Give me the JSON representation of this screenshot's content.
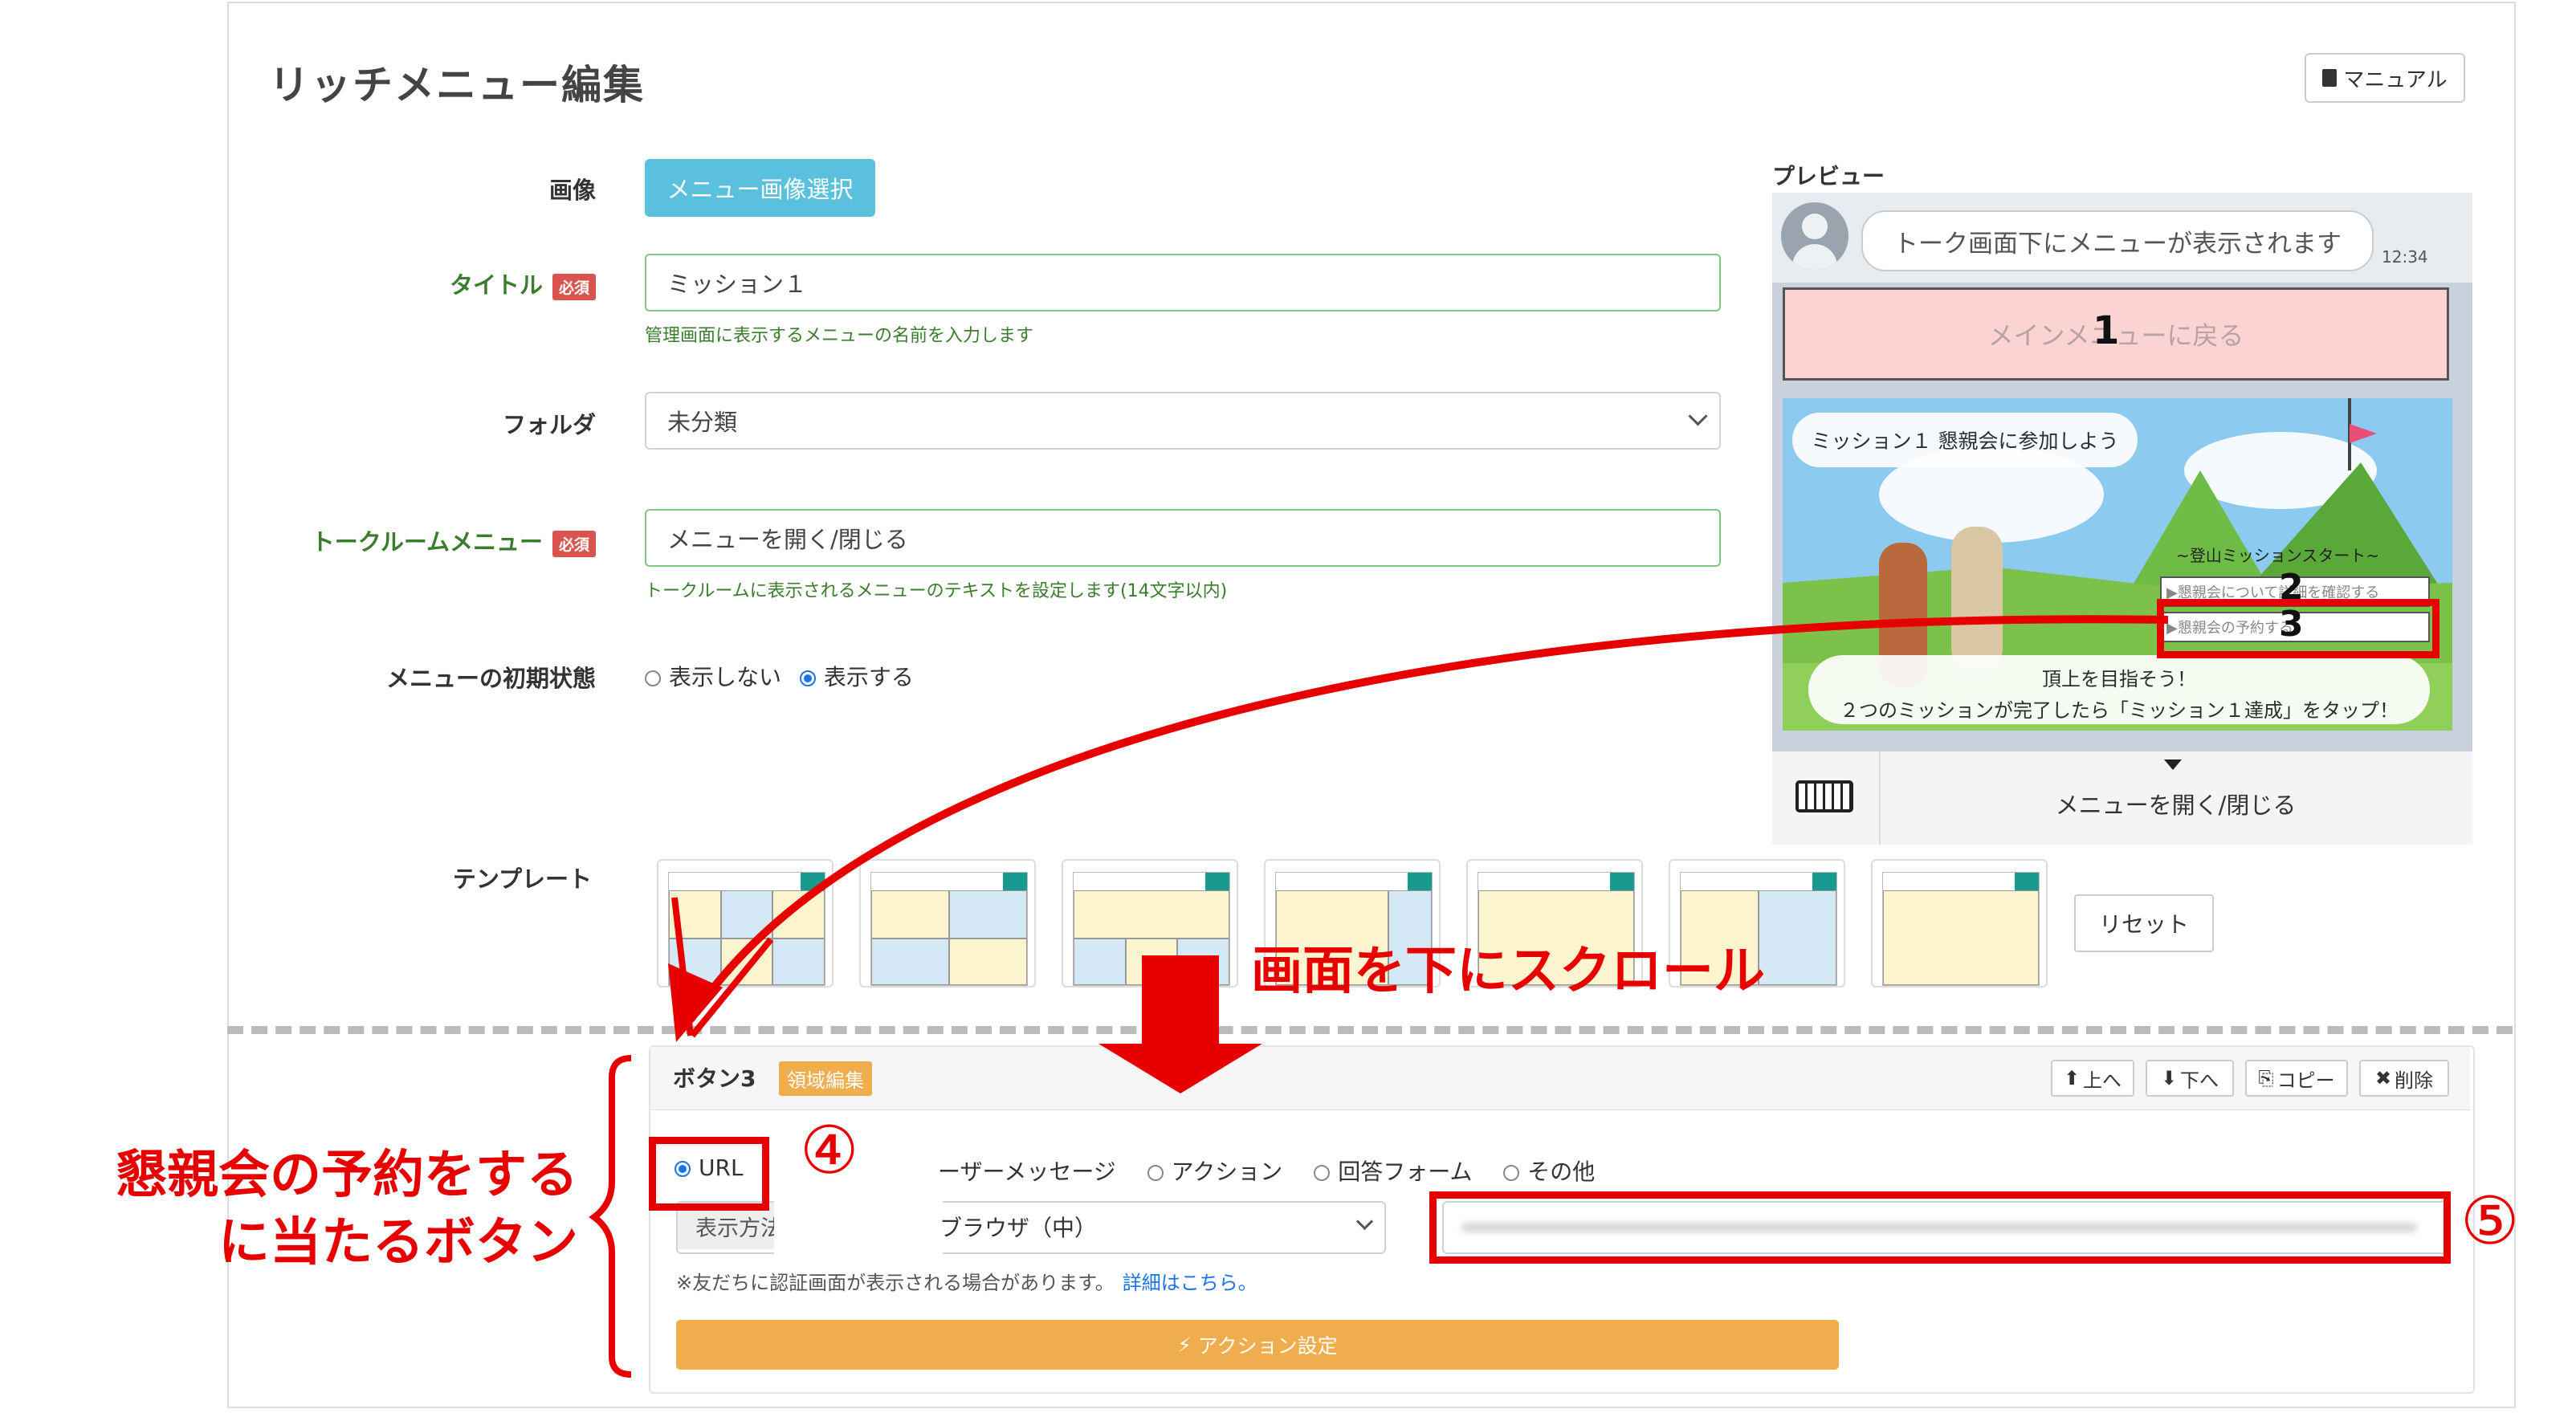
{
  "header": {
    "title": "リッチメニュー編集",
    "manual_label": "マニュアル"
  },
  "form": {
    "image_label": "画像",
    "image_button": "メニュー画像選択",
    "title_label": "タイトル",
    "required": "必須",
    "title_value": "ミッション１",
    "title_help": "管理画面に表示するメニューの名前を入力します",
    "folder_label": "フォルダ",
    "folder_value": "未分類",
    "talkroom_label": "トークルームメニュー",
    "talkroom_value": "メニューを開く/閉じる",
    "talkroom_help": "トークルームに表示されるメニューのテキストを設定します(14文字以内)",
    "initial_label": "メニューの初期状態",
    "initial_options": [
      "表示しない",
      "表示する"
    ],
    "template_label": "テンプレート",
    "reset_label": "リセット"
  },
  "preview": {
    "label": "プレビュー",
    "bubble": "トーク画面下にメニューが表示されます",
    "time": "12:34",
    "main_menu": "メインメニューに戻る",
    "num1": "1",
    "num2": "2",
    "num3": "3",
    "mission_title": "ミッション１ 懇親会に参加しよう",
    "start": "~登山ミッションスタート~",
    "item2": "▶懇親会について詳細を確認する",
    "item3": "▶懇親会の予約する",
    "goal1": "頂上を目指そう！",
    "goal2": "２つのミッションが完了したら「ミッション１達成」をタップ！",
    "toggle": "メニューを開く/閉じる"
  },
  "button_section": {
    "title": "ボタン3",
    "badge": "領域編集",
    "up": "上へ",
    "down": "下へ",
    "copy": "コピー",
    "delete": "削除",
    "options": [
      "URL",
      "ーザーメッセージ",
      "アクション",
      "回答フォーム",
      "その他"
    ],
    "display_prefix": "表示方法",
    "display_value": "ブラウザ（中）",
    "note": "※友だちに認証画面が表示される場合があります。",
    "detail_link": "詳細はこちら。",
    "action_button": "アクション設定"
  },
  "annotations": {
    "scroll": "画面を下にスクロール",
    "target_line1": "懇親会の予約をする",
    "target_line2": "に当たるボタン",
    "step4": "④",
    "step5": "⑤"
  },
  "colors": {
    "accent_red": "#e60000",
    "info_blue": "#5bc0de",
    "orange": "#f0ad4e",
    "green_label": "#3a7d2c"
  }
}
